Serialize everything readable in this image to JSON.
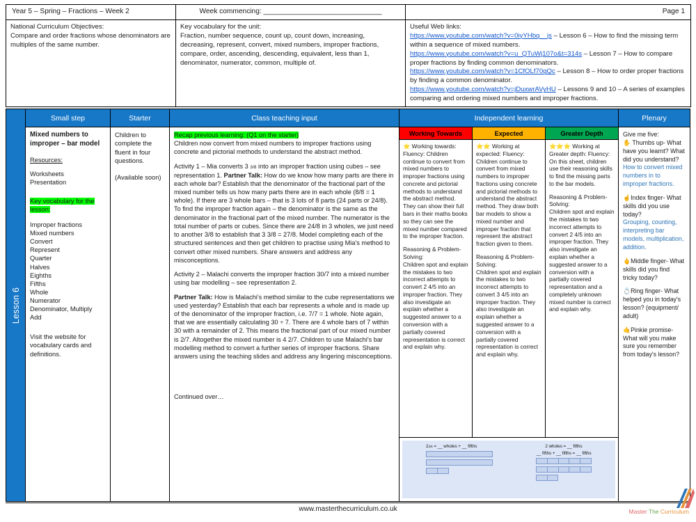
{
  "header": {
    "left": "Year 5 – Spring – Fractions – Week 2",
    "middle": "Week commencing: ______________________________",
    "right": "Page 1"
  },
  "info": {
    "objectives_title": "National Curriculum Objectives:",
    "objectives_text": "Compare and order fractions whose denominators are multiples of the same number.",
    "vocab_title": "Key vocabulary for the unit:",
    "vocab_text": "Fraction, number sequence, count up, count down, increasing, decreasing, represent, convert, mixed numbers, improper fractions, compare, order, ascending, descending, equivalent, less than 1, denominator, numerator, common, multiple of.",
    "links_title": "Useful Web links:",
    "links": [
      {
        "url": "https://www.youtube.com/watch?v=0iyYHbq__js",
        "desc": " – Lesson 6 – How to find the missing term within a sequence of mixed numbers."
      },
      {
        "url": "https://www.youtube.com/watch?v=u_QTuWj107o&t=314s",
        "desc": " – Lesson 7 – How to compare proper fractions by finding common denominators."
      },
      {
        "url": "https://www.youtube.com/watch?v=1CfOLf70gQc",
        "desc": " – Lesson 8 – How to order proper fractions by finding a common denominator."
      },
      {
        "url": "https://www.youtube.com/watch?v=jDuxwrAVyHU",
        "desc": " – Lessons 9 and 10 – A series of examples comparing and ordering mixed numbers and improper fractions."
      }
    ]
  },
  "lesson_spine": "Lesson 6",
  "columns": {
    "small_step": "Small step",
    "starter": "Starter",
    "teaching": "Class teaching input",
    "independent": "Independent learning",
    "plenary": "Plenary"
  },
  "small_step": {
    "title": "Mixed numbers to improper – bar model",
    "resources_label": "Resources:",
    "resources": [
      "Worksheets",
      "Presentation"
    ],
    "vocab_label": "Key vocabulary for the lesson:",
    "vocab": [
      "Improper fractions",
      "Mixed numbers",
      "Convert",
      "Represent",
      "Quarter",
      "Halves",
      "Eighths",
      "Fifths",
      "Whole",
      "Numerator",
      "Denominator, Multiply",
      "Add"
    ],
    "footer_note": "Visit the website for vocabulary cards and definitions."
  },
  "starter": {
    "text": "Children to complete the fluent in four questions.",
    "note": "(Available soon)"
  },
  "teaching": {
    "recap_highlight": "Recap previous learning: (Q1 on the starter)",
    "intro": "Children now convert from mixed numbers to improper fractions using concrete and pictorial methods to understand the abstract method.",
    "activity1_lead": "Activity 1 – Mia converts 3 ",
    "activity1_frac": "3/8",
    "activity1_mid": " into an improper fraction using cubes – see representation 1. ",
    "partner_talk_label": "Partner Talk:",
    "activity1_body": " How do we know how many parts are there in each whole bar? Establish that the denominator of the fractional part of the mixed number tells us how many parts there are in each whole (8/8 = 1 whole). If there are 3 whole bars – that is 3 lots of 8 parts (24 parts or 24/8). To find the improper fraction again – the denominator is the same as the denominator in the fractional part of the mixed number. The numerator is the total number of parts or cubes. Since there are 24/8 in 3 wholes, we just need to another 3/8 to establish that 3 3/8 = 27/8. Model completing each of the structured sentences and then get children to practise using Mia's method to convert other mixed numbers. Share answers and address any misconceptions.",
    "activity2": "Activity 2 – Malachi converts the improper fraction 30/7 into a mixed number using bar modelling – see representation 2.",
    "partner_talk2_label": "Partner Talk:",
    "activity2_body": " How is Malachi's method similar to the cube representations we used yesterday? Establish that each bar represents a whole and is made up of the denominator of the improper fraction, i.e. 7/7 = 1 whole. Note again, that we are essentially calculating 30 ÷ 7. There are 4 whole bars of 7 within 30 with a remainder of 2. This means the fractional part of our mixed number is 2/7. Altogether the mixed number is 4 2/7. Children to use Malachi's bar modelling method to convert a further series of improper fractions. Share answers using the teaching slides and address any lingering misconceptions.",
    "continued": "Continued over…"
  },
  "independent": {
    "working_towards": {
      "header": "Working Towards",
      "color": "#ff0000",
      "stars": "⭐",
      "fluency": " Working towards: Fluency: Children continue to convert from mixed numbers to improper fractions using concrete and pictorial methods to understand the abstract method. They can show their full bars in their maths books so they can see the mixed number compared to the improper fraction.",
      "rps_label": "Reasoning & Problem-Solving:",
      "rps_text": "Children spot and explain the mistakes to two incorrect attempts to convert 2 4/5 into an improper fraction. They also investigate an explain whether a suggested answer to a conversion with a partially covered representation is correct and explain why."
    },
    "expected": {
      "header": "Expected",
      "color": "#ffb300",
      "stars": "⭐⭐",
      "fluency": " Working at expected: Fluency: Children continue to convert from mixed numbers to improper fractions using concrete and pictorial methods to understand the abstract method. They draw both bar models to show a mixed number and improper fraction that represent the abstract fraction given to them.",
      "rps_label": "Reasoning & Problem-Solving:",
      "rps_text": "Children spot and explain the mistakes to two incorrect attempts to convert 3 4/5 into an improper fraction. They also investigate an explain whether a suggested answer to a conversion with a partially covered representation is correct and explain why."
    },
    "greater_depth": {
      "header": "Greater Depth",
      "color": "#00a651",
      "stars": "⭐⭐⭐",
      "fluency": " Working at Greater depth: Fluency: On this sheet, children use their reasoning skills to find the missing parts to the bar models.",
      "rps_label": "Reasoning & Problem-Solving:",
      "rps_text": "Children spot and explain the mistakes to two incorrect attempts to convert 2 4/5 into an improper fraction. They also investigate an explain whether a suggested answer to a conversion with a partially covered representation and a completely unknown mixed number is correct and explain why."
    },
    "diagram": {
      "left_caption_a": "2",
      "left_caption_frac": "2/5",
      "left_caption_b": " = __ wholes + __ fifths",
      "right_caption_line1": "2 wholes = __ fifths",
      "right_caption_line2": "__ fifths + __ fifths = __ fifths"
    }
  },
  "plenary": {
    "intro": "Give me five:",
    "items": [
      {
        "hand": "✋",
        "q": " Thumbs up- What have you learnt? What did you understand?",
        "a": "How to convert mixed numbers in to improper fractions."
      },
      {
        "hand": "☝",
        "q": "Index finger- What skills did you use today?",
        "a": "Grouping, counting, interpreting bar models, multiplication, addition."
      },
      {
        "hand": "🖕",
        "q": "Middle finger- What skills did you find tricky today?",
        "a": ""
      },
      {
        "hand": "💍",
        "q": "Ring finger- What helped you in today's lesson? (equipment/ adult)",
        "a": ""
      },
      {
        "hand": "🤙",
        "q": "Pinkie promise- What will you make sure you remember from today's lesson?",
        "a": ""
      }
    ]
  },
  "footer": {
    "website": "www.masterthecurriculum.co.uk",
    "brand_1": "Master",
    "brand_2": "The",
    "brand_3": "Curriculum"
  }
}
